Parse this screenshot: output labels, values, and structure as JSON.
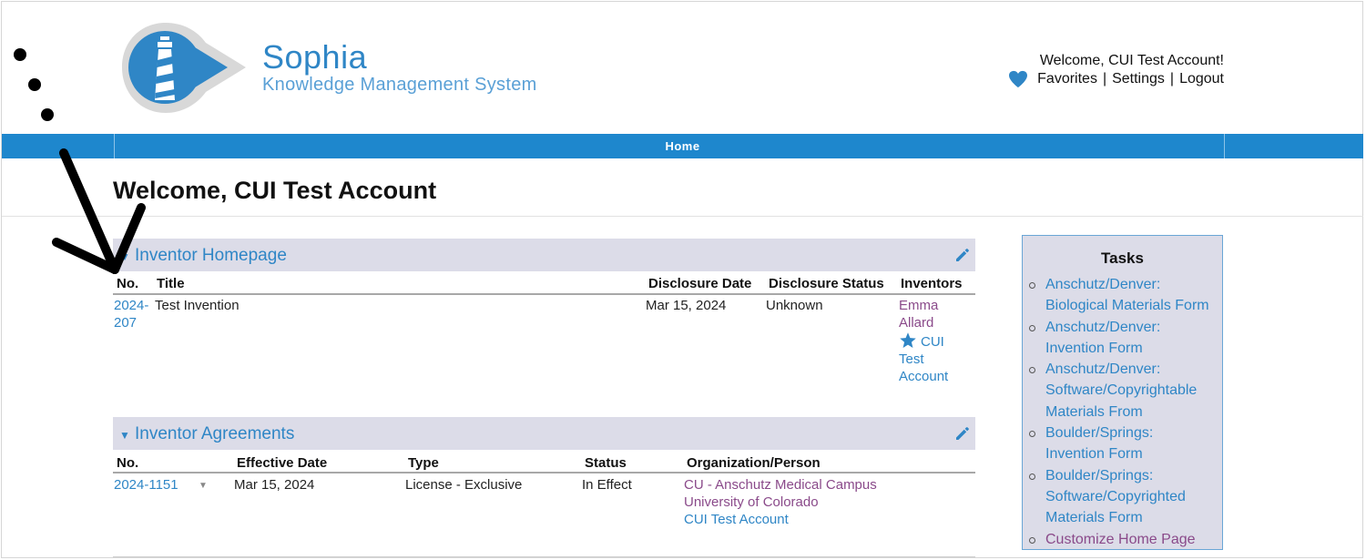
{
  "header": {
    "brand_title": "Sophia",
    "brand_subtitle": "Knowledge Management System",
    "welcome_user": "Welcome, CUI Test Account!",
    "links": [
      "Favorites",
      "Settings",
      "Logout"
    ],
    "link_separator": "|"
  },
  "nav": {
    "home_label": "Home"
  },
  "page_title": "Welcome, CUI Test Account",
  "inventor_homepage": {
    "title": "Inventor Homepage",
    "columns": [
      "No.",
      "Title",
      "Disclosure Date",
      "Disclosure Status",
      "Inventors"
    ],
    "rows": [
      {
        "no_line1": "2024-",
        "no_line2": "207",
        "title": "Test Invention",
        "disclosure_date": "Mar 15, 2024",
        "disclosure_status": "Unknown",
        "inventor1_line1": "Emma",
        "inventor1_line2": "Allard",
        "inventor2_line1": "CUI",
        "inventor2_line2": "Test",
        "inventor2_line3": "Account"
      }
    ]
  },
  "inventor_agreements": {
    "title": "Inventor Agreements",
    "columns": [
      "No.",
      "Effective Date",
      "Type",
      "Status",
      "Organization/Person"
    ],
    "rows": [
      {
        "no": "2024-1151",
        "effective_date": "Mar 15, 2024",
        "type": "License - Exclusive",
        "status": "In Effect",
        "org_line1": "CU - Anschutz Medical Campus",
        "org_line2": "University of Colorado",
        "org_line3": "CUI Test Account"
      }
    ]
  },
  "tasks": {
    "title": "Tasks",
    "items": [
      {
        "line1": "Anschutz/Denver:",
        "line2": "Biological Materials Form"
      },
      {
        "line1": "Anschutz/Denver:",
        "line2": "Invention Form"
      },
      {
        "line1": "Anschutz/Denver:",
        "line2": "Software/Copyrightable",
        "line3": "Materials From"
      },
      {
        "line1": "Boulder/Springs:",
        "line2": "Invention Form"
      },
      {
        "line1": "Boulder/Springs:",
        "line2": "Software/Copyrighted",
        "line3": "Materials Form"
      },
      {
        "line1": "Customize Home Page"
      }
    ]
  },
  "colors": {
    "nav_blue": "#1e87cd",
    "link_blue": "#2f86c6",
    "link_purple": "#8a4a8a",
    "section_bg": "#dcdce8"
  },
  "icons": [
    "lighthouse-logo-icon",
    "heart-icon",
    "pencil-icon",
    "star-icon",
    "chevron-down-icon",
    "triangle-down-icon"
  ]
}
